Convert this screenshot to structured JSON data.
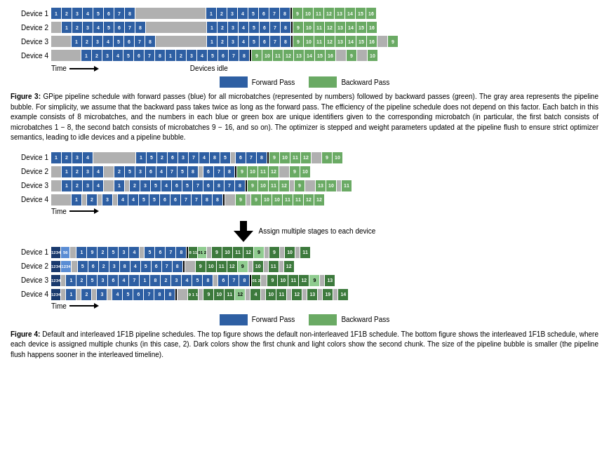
{
  "figures": {
    "fig3": {
      "title": "Figure 3:",
      "caption": "GPipe pipeline schedule with forward passes (blue) for all microbatches (represented by numbers) followed by backward passes (green). The gray area represents the pipeline bubble. For simplicity, we assume that the backward pass takes twice as long as the forward pass. The efficiency of the pipeline schedule does not depend on this factor. Each batch in this example consists of 8 microbatches, and the numbers in each blue or green box are unique identifiers given to the corresponding microbatch (in particular, the first batch consists of microbatches 1 − 8, the second batch consists of microbatches 9 − 16, and so on). The optimizer is stepped and weight parameters updated at the pipeline flush to ensure strict optimizer semantics, leading to idle devices and a pipeline bubble.",
      "devices": [
        "Device 1",
        "Device 2",
        "Device 3",
        "Device 4"
      ],
      "time_label": "Time",
      "idle_label": "Devices idle",
      "forward_label": "Forward Pass",
      "backward_label": "Backward Pass"
    },
    "fig4": {
      "title": "Figure 4:",
      "caption": "Default and interleaved 1F1B pipeline schedules. The top figure shows the default non-interleaved 1F1B schedule. The bottom figure shows the interleaved 1F1B schedule, where each device is assigned multiple chunks (in this case, 2). Dark colors show the first chunk and light colors show the second chunk. The size of the pipeline bubble is smaller (the pipeline flush happens sooner in the interleaved timeline).",
      "devices": [
        "Device 1",
        "Device 2",
        "Device 3",
        "Device 4"
      ],
      "assign_label": "Assign multiple stages\nto each device",
      "forward_label": "Forward Pass",
      "backward_label": "Backward Pass"
    }
  }
}
